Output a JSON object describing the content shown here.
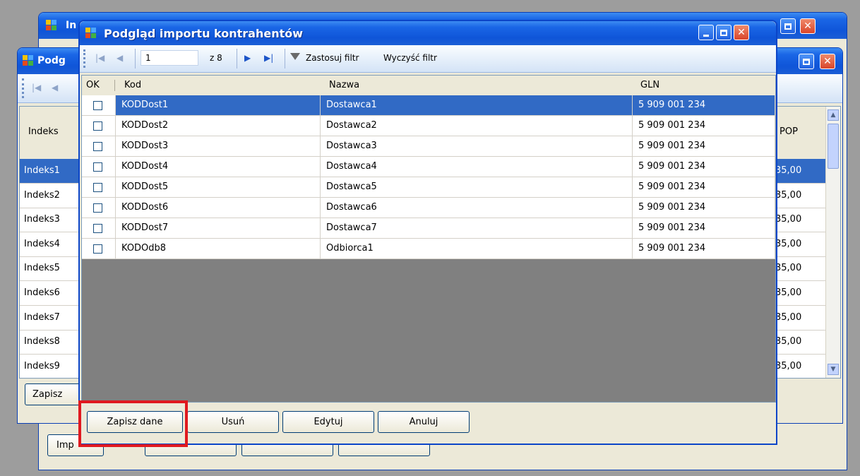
{
  "back_window_1": {
    "title": "In"
  },
  "back_window_2": {
    "title": "Podg",
    "header_indeks": "Indeks",
    "header_pop": "POP",
    "rows": [
      "Indeks1",
      "Indeks2",
      "Indeks3",
      "Indeks4",
      "Indeks5",
      "Indeks6",
      "Indeks7",
      "Indeks8",
      "Indeks9"
    ],
    "values": [
      "35,00",
      "35,00",
      "35,00",
      "35,00",
      "35,00",
      "35,00",
      "35,00",
      "35,00",
      "35,00"
    ],
    "save_label": "Zapisz",
    "import_label": "Imp"
  },
  "dialog": {
    "title": "Podgląd importu kontrahentów",
    "nav": {
      "position": "1",
      "of_count": "z 8",
      "apply_filter": "Zastosuj filtr",
      "clear_filter": "Wyczyść filtr"
    },
    "columns": {
      "ok": "OK",
      "kod": "Kod",
      "nazwa": "Nazwa",
      "gln": "GLN"
    },
    "rows": [
      {
        "kod": "KODDost1",
        "nazwa": "Dostawca1",
        "gln": "5 909 001 234",
        "selected": true
      },
      {
        "kod": "KODDost2",
        "nazwa": "Dostawca2",
        "gln": "5 909 001 234"
      },
      {
        "kod": "KODDost3",
        "nazwa": "Dostawca3",
        "gln": "5 909 001 234"
      },
      {
        "kod": "KODDost4",
        "nazwa": "Dostawca4",
        "gln": "5 909 001 234"
      },
      {
        "kod": "KODDost5",
        "nazwa": "Dostawca5",
        "gln": "5 909 001 234"
      },
      {
        "kod": "KODDost6",
        "nazwa": "Dostawca6",
        "gln": "5 909 001 234"
      },
      {
        "kod": "KODDost7",
        "nazwa": "Dostawca7",
        "gln": "5 909 001 234"
      },
      {
        "kod": "KODOdb8",
        "nazwa": "Odbiorca1",
        "gln": "5 909 001 234"
      }
    ],
    "buttons": {
      "save": "Zapisz dane",
      "delete": "Usuń",
      "edit": "Edytuj",
      "cancel": "Anuluj"
    }
  },
  "colors": {
    "selection": "#316ac5",
    "highlight": "#e0191f",
    "title_blue": "#0f55d8"
  }
}
